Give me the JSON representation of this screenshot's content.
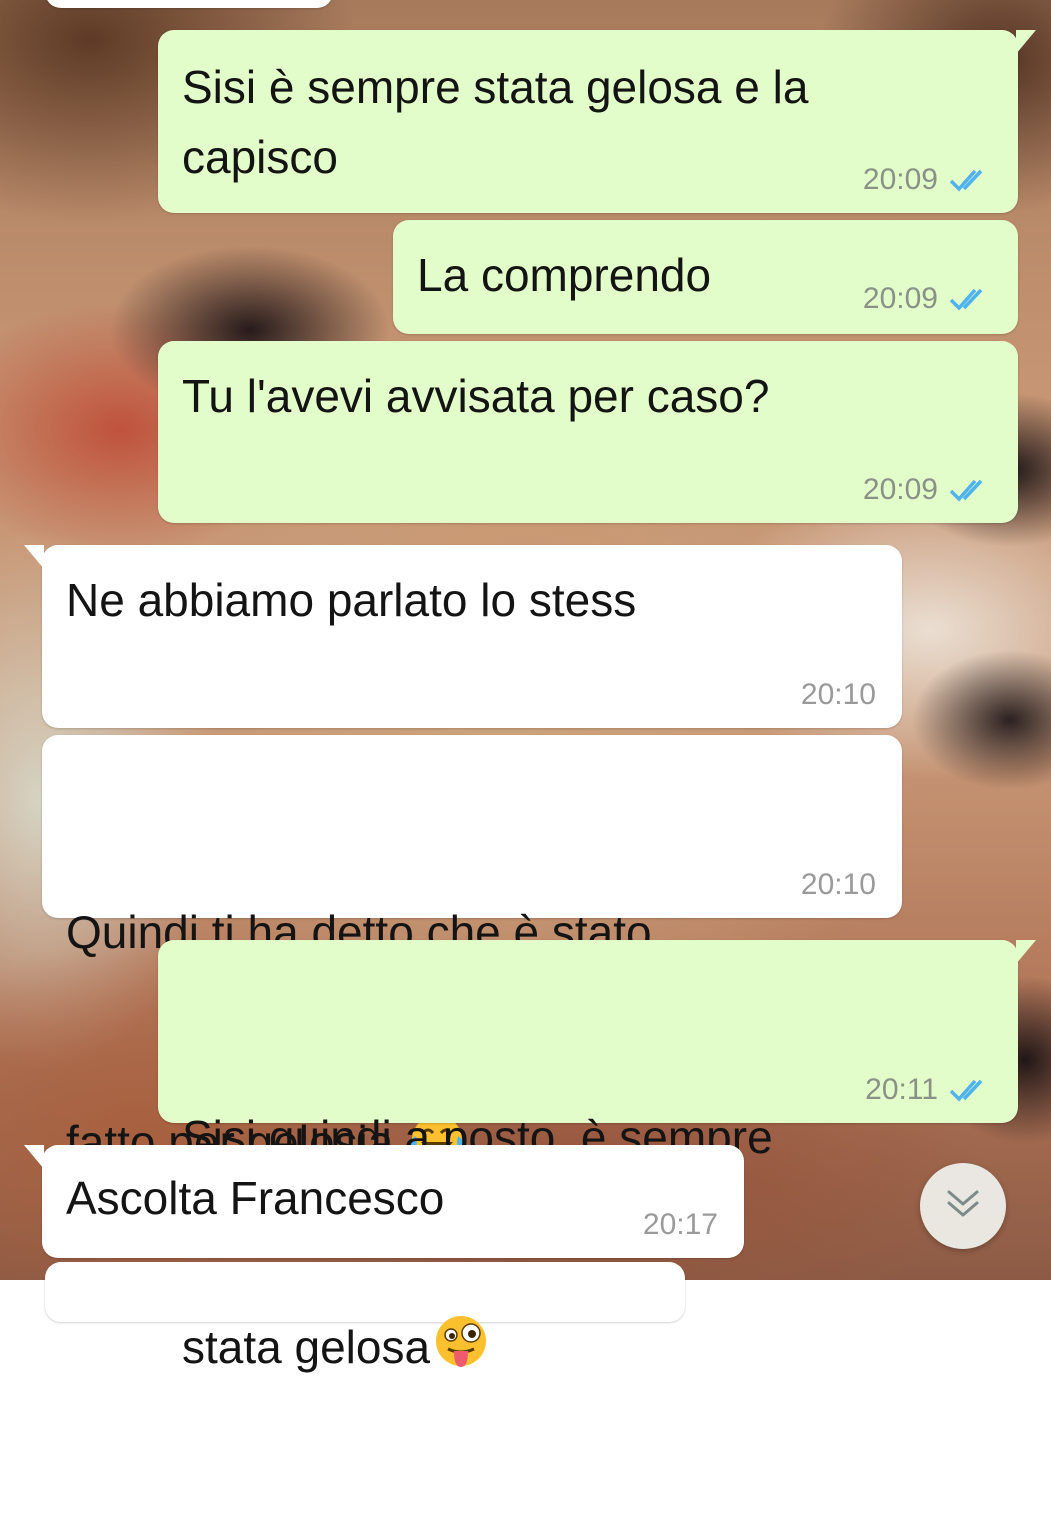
{
  "messages": [
    {
      "id": "m1",
      "direction": "out",
      "text": "Sisi è sempre stata gelosa e la\ncapisco",
      "time": "20:09",
      "status": "read"
    },
    {
      "id": "m2",
      "direction": "out",
      "text": "La comprendo",
      "time": "20:09",
      "status": "read"
    },
    {
      "id": "m3",
      "direction": "out",
      "text": "Tu l'avevi avvisata per caso?",
      "time": "20:09",
      "status": "read"
    },
    {
      "id": "m4",
      "direction": "in",
      "text": "Ne abbiamo parlato lo stess",
      "time": "20:10"
    },
    {
      "id": "m5",
      "direction": "in",
      "text_line1": "Quindi ti ha detto che è stato",
      "text_line2": "fatto per gelosia ",
      "emoji": "tears-of-joy-emoji",
      "time": "20:10"
    },
    {
      "id": "m6",
      "direction": "out",
      "text_line1": "Sisi quindi a posto, è sempre",
      "text_line2": "stata gelosa",
      "emoji": "winking-tongue-emoji",
      "time": "20:11",
      "status": "read"
    },
    {
      "id": "m7",
      "direction": "in",
      "text": "Ascolta Francesco",
      "time": "20:17"
    }
  ],
  "colors": {
    "outgoing_bubble": "#e2fdc9",
    "incoming_bubble": "#ffffff",
    "read_ticks": "#4fb3f0",
    "timestamp": "#8a9288"
  },
  "scroll_button": {
    "icon": "chevron-double-down-icon"
  }
}
